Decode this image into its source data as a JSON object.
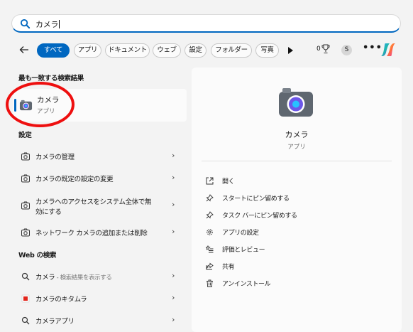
{
  "search": {
    "query": "カメラ"
  },
  "filters": [
    {
      "label": "すべて",
      "active": true
    },
    {
      "label": "アプリ"
    },
    {
      "label": "ドキュメント"
    },
    {
      "label": "ウェブ"
    },
    {
      "label": "設定"
    },
    {
      "label": "フォルダー"
    },
    {
      "label": "写真"
    }
  ],
  "header_extras": {
    "points": "0",
    "avatar": "S",
    "more": "•••"
  },
  "best_match": {
    "heading": "最も一致する検索結果",
    "title": "カメラ",
    "subtitle": "アプリ"
  },
  "settings": {
    "heading": "設定",
    "items": [
      {
        "label": "カメラの管理"
      },
      {
        "label": "カメラの既定の設定の変更"
      },
      {
        "label_line1": "カメラへのアクセスをシステム全体で無",
        "label_line2": "効にする"
      },
      {
        "label": "ネットワーク カメラの追加または削除"
      }
    ]
  },
  "web": {
    "heading": "Web の検索",
    "items": [
      {
        "label": "カメラ",
        "suffix": " - 検索結果を表示する"
      },
      {
        "label": "カメラのキタムラ"
      },
      {
        "label": "カメラアプリ"
      }
    ]
  },
  "preview": {
    "title": "カメラ",
    "subtitle": "アプリ",
    "actions": [
      {
        "label": "開く",
        "icon": "open-icon"
      },
      {
        "label": "スタートにピン留めする",
        "icon": "pin-icon"
      },
      {
        "label": "タスク バーにピン留めする",
        "icon": "pin-icon"
      },
      {
        "label": "アプリの設定",
        "icon": "gear-icon"
      },
      {
        "label": "評価とレビュー",
        "icon": "star-list-icon"
      },
      {
        "label": "共有",
        "icon": "share-icon"
      },
      {
        "label": "アンインストール",
        "icon": "trash-icon"
      }
    ]
  },
  "colors": {
    "accent": "#0067c0",
    "highlight_circle": "#ee0f0f",
    "camera_body": "#5f6770"
  }
}
